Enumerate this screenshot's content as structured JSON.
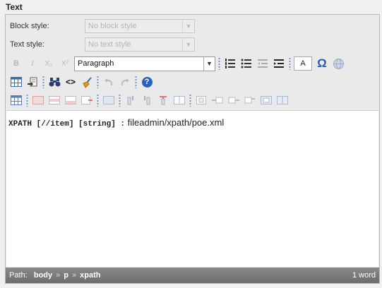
{
  "section_title": "Text",
  "block_style": {
    "label": "Block style:",
    "value": "No block style"
  },
  "text_style": {
    "label": "Text style:",
    "value": "No text style"
  },
  "toolbar1": {
    "bold": "B",
    "italic": "I",
    "subscript": "X₂",
    "superscript": "X²",
    "format_value": "Paragraph",
    "text_color": "A",
    "special_char": "Ω"
  },
  "toolbar2": {
    "source": "<>",
    "help": "?"
  },
  "content": {
    "code": "XPATH [//item] [string] :",
    "path": " fileadmin/xpath/poe.xml"
  },
  "status": {
    "path_label": "Path:",
    "crumbs": [
      "body",
      "p",
      "xpath"
    ],
    "separator": "»",
    "word_count": "1 word"
  }
}
